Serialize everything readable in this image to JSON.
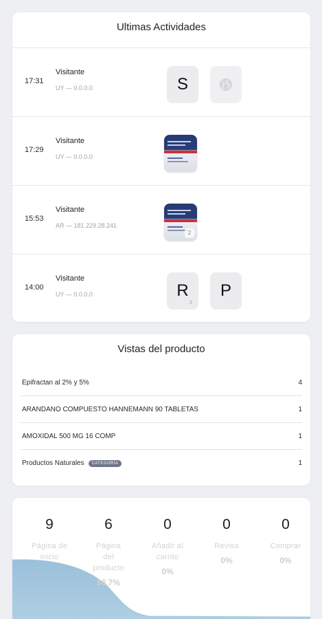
{
  "activities": {
    "title": "Ultimas Actividades",
    "rows": [
      {
        "time": "17:31",
        "name": "Visitante",
        "sub": "UY — 0.0.0.0",
        "tile1": "S",
        "tile2_icon": "globe-icon"
      },
      {
        "time": "17:29",
        "name": "Visitante",
        "sub": "UY — 0.0.0.0"
      },
      {
        "time": "15:53",
        "name": "Visitante",
        "sub": "AR — 181.229.28.241",
        "count": "2"
      },
      {
        "time": "14:00",
        "name": "Visitante",
        "sub": "UY — 0.0.0.0",
        "tile1": "R",
        "tile1_count": "2",
        "tile2": "P"
      }
    ]
  },
  "views": {
    "title": "Vistas del producto",
    "rows": [
      {
        "name": "Epifractan al 2% y 5%",
        "count": "4"
      },
      {
        "name": "ARANDANO COMPUESTO HANNEMANN 90 TABLETAS",
        "count": "1"
      },
      {
        "name": "AMOXIDAL 500 MG 16 COMP",
        "count": "1"
      },
      {
        "name": "Productos Naturales",
        "badge": "CATEGORÍA",
        "count": "1"
      }
    ]
  },
  "funnel": {
    "steps": [
      {
        "value": "9",
        "label_1": "Página de",
        "label_2": "inicio",
        "label_3": "",
        "pct": ""
      },
      {
        "value": "6",
        "label_1": "Página",
        "label_2": "del",
        "label_3": "producto",
        "pct": "66.7%"
      },
      {
        "value": "0",
        "label_1": "Añadir al",
        "label_2": "carrito",
        "label_3": "",
        "pct": "0%"
      },
      {
        "value": "0",
        "label_1": "Revisa",
        "label_2": "",
        "label_3": "",
        "pct": "0%"
      },
      {
        "value": "0",
        "label_1": "Comprar",
        "label_2": "",
        "label_3": "",
        "pct": "0%"
      }
    ],
    "wave_color": "#8fb9d6"
  }
}
